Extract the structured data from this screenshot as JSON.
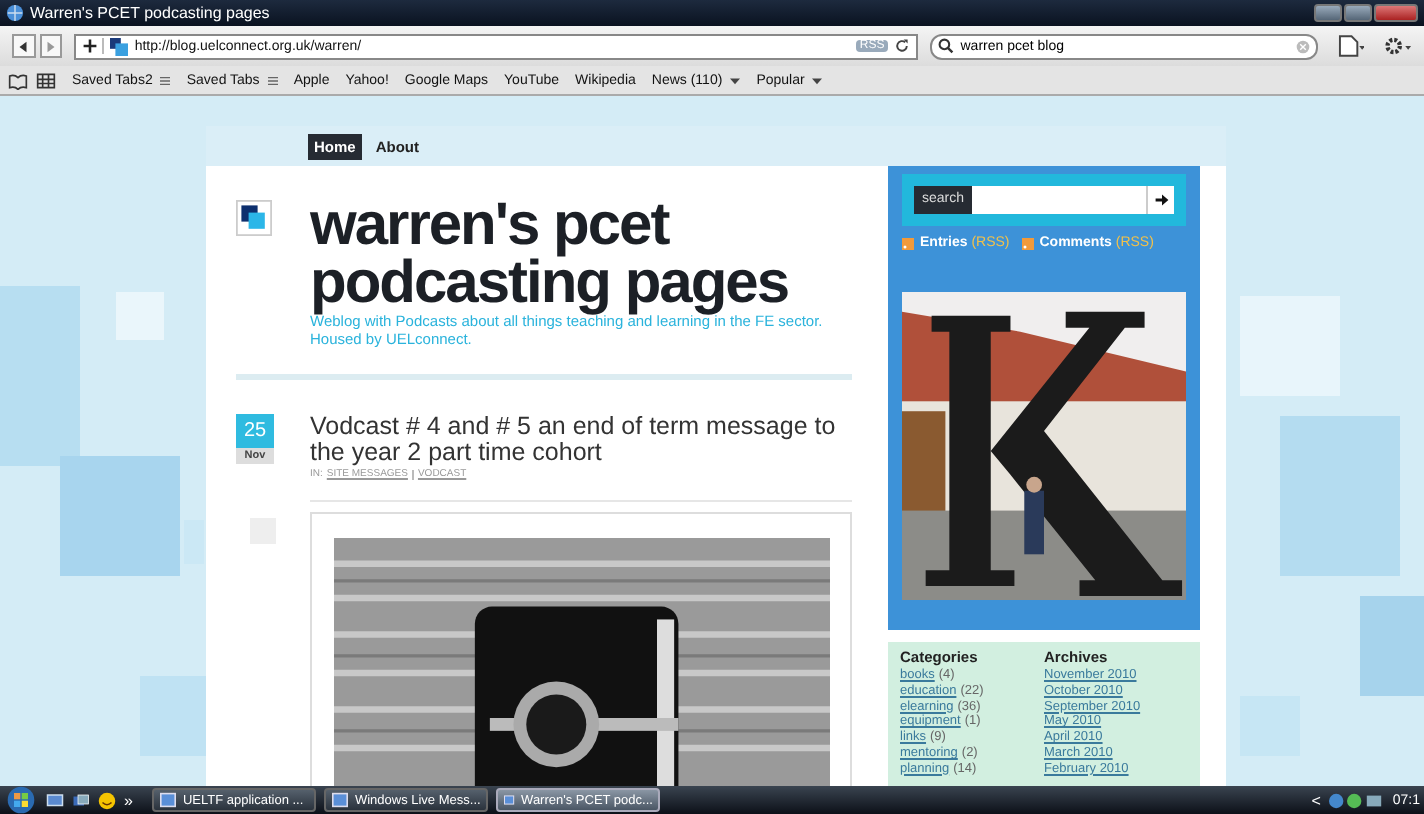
{
  "window": {
    "title": "Warren's PCET podcasting pages"
  },
  "browser": {
    "url": "http://blog.uelconnect.org.uk/warren/",
    "rss_badge": "RSS",
    "search_value": "warren pcet blog",
    "bookmarks": [
      {
        "label": "Saved Tabs2",
        "kind": "folder"
      },
      {
        "label": "Saved Tabs",
        "kind": "folder"
      },
      {
        "label": "Apple",
        "kind": "link"
      },
      {
        "label": "Yahoo!",
        "kind": "link"
      },
      {
        "label": "Google Maps",
        "kind": "link"
      },
      {
        "label": "YouTube",
        "kind": "link"
      },
      {
        "label": "Wikipedia",
        "kind": "link"
      },
      {
        "label": "News (110)",
        "kind": "menu"
      },
      {
        "label": "Popular",
        "kind": "menu"
      }
    ]
  },
  "site_nav": [
    {
      "label": "Home",
      "selected": true
    },
    {
      "label": "About",
      "selected": false
    }
  ],
  "header": {
    "title": "warren's pcet podcasting pages",
    "tagline": "Weblog with Podcasts about all things teaching and learning in the FE sector. Housed by UELconnect."
  },
  "post": {
    "day": "25",
    "month": "Nov",
    "title": "Vodcast # 4 and # 5 an end of term message to the year 2 part time cohort",
    "meta_prefix": "IN:",
    "categories": [
      "SITE MESSAGES",
      "VODCAST"
    ]
  },
  "sidebar": {
    "search_label": "search",
    "feeds": [
      {
        "label": "Entries",
        "tag": "(RSS)"
      },
      {
        "label": "Comments",
        "tag": "(RSS)"
      }
    ],
    "categories": {
      "heading": "Categories",
      "items": [
        {
          "name": "books",
          "count": "(4)"
        },
        {
          "name": "education",
          "count": "(22)"
        },
        {
          "name": "elearning",
          "count": "(36)"
        },
        {
          "name": "equipment",
          "count": "(1)"
        },
        {
          "name": "links",
          "count": "(9)"
        },
        {
          "name": "mentoring",
          "count": "(2)"
        },
        {
          "name": "planning",
          "count": "(14)"
        }
      ]
    },
    "archives": {
      "heading": "Archives",
      "items": [
        "November 2010",
        "October 2010",
        "September 2010",
        "May 2010",
        "April 2010",
        "March 2010",
        "February 2010"
      ]
    }
  },
  "taskbar": {
    "overflow": "»",
    "tasks": [
      {
        "label": "UELTF application ...",
        "selected": false
      },
      {
        "label": "Windows Live Mess...",
        "selected": false
      },
      {
        "label": "Warren's PCET podc...",
        "selected": true
      }
    ],
    "tray_arrow": "<",
    "clock": "07:1"
  }
}
